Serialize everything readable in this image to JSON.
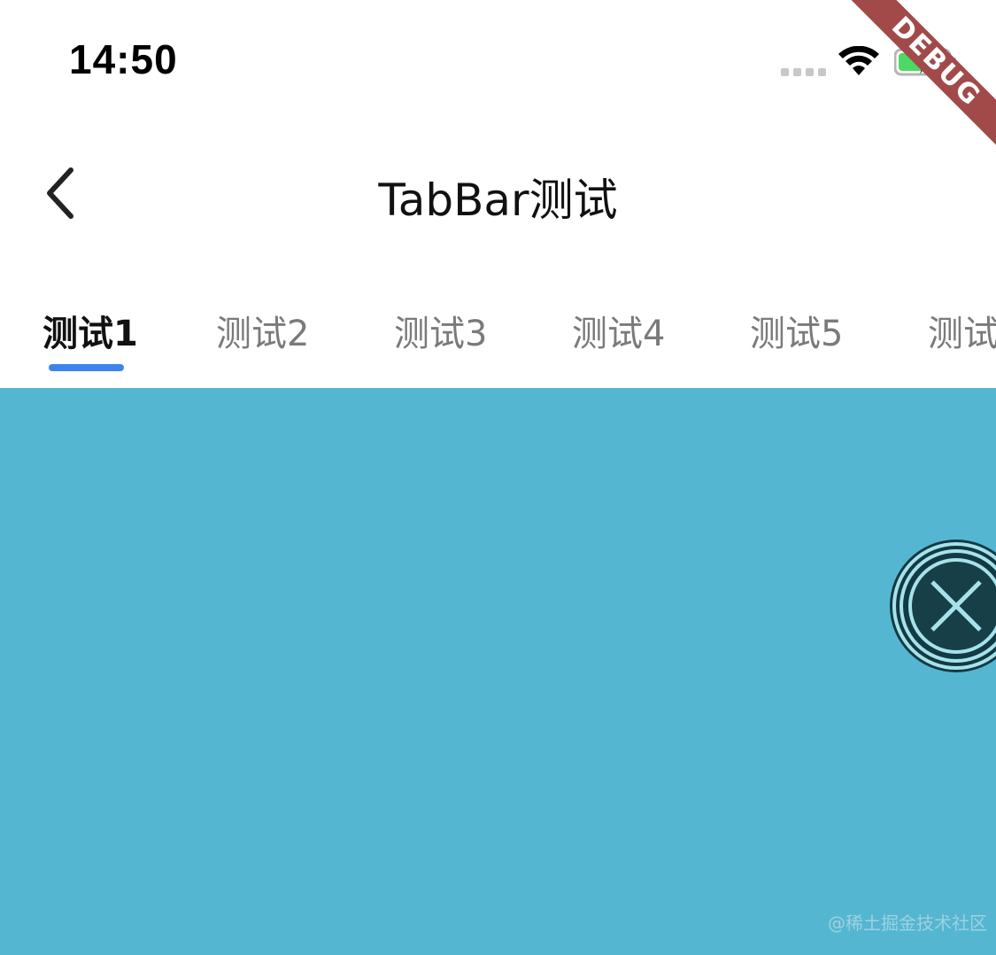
{
  "status_bar": {
    "time": "14:50",
    "signal_icon": "cellular-signal-icon",
    "wifi_icon": "wifi-icon",
    "battery_icon": "battery-charging-icon",
    "battery_color": "#4cd964"
  },
  "debug_banner": {
    "label": "DEBUG",
    "color": "#a24a4a"
  },
  "nav": {
    "back_icon": "chevron-left-icon",
    "title": "TabBar测试"
  },
  "tabs": [
    {
      "label": "测试1",
      "active": true
    },
    {
      "label": "测试2",
      "active": false
    },
    {
      "label": "测试3",
      "active": false
    },
    {
      "label": "测试4",
      "active": false
    },
    {
      "label": "测试5",
      "active": false
    },
    {
      "label": "测试",
      "active": false
    }
  ],
  "tab_indicator_color": "#3c84ec",
  "content": {
    "background": "#55b6d1",
    "float_button_icon": "close-icon"
  },
  "watermark": "@稀土掘金技术社区"
}
